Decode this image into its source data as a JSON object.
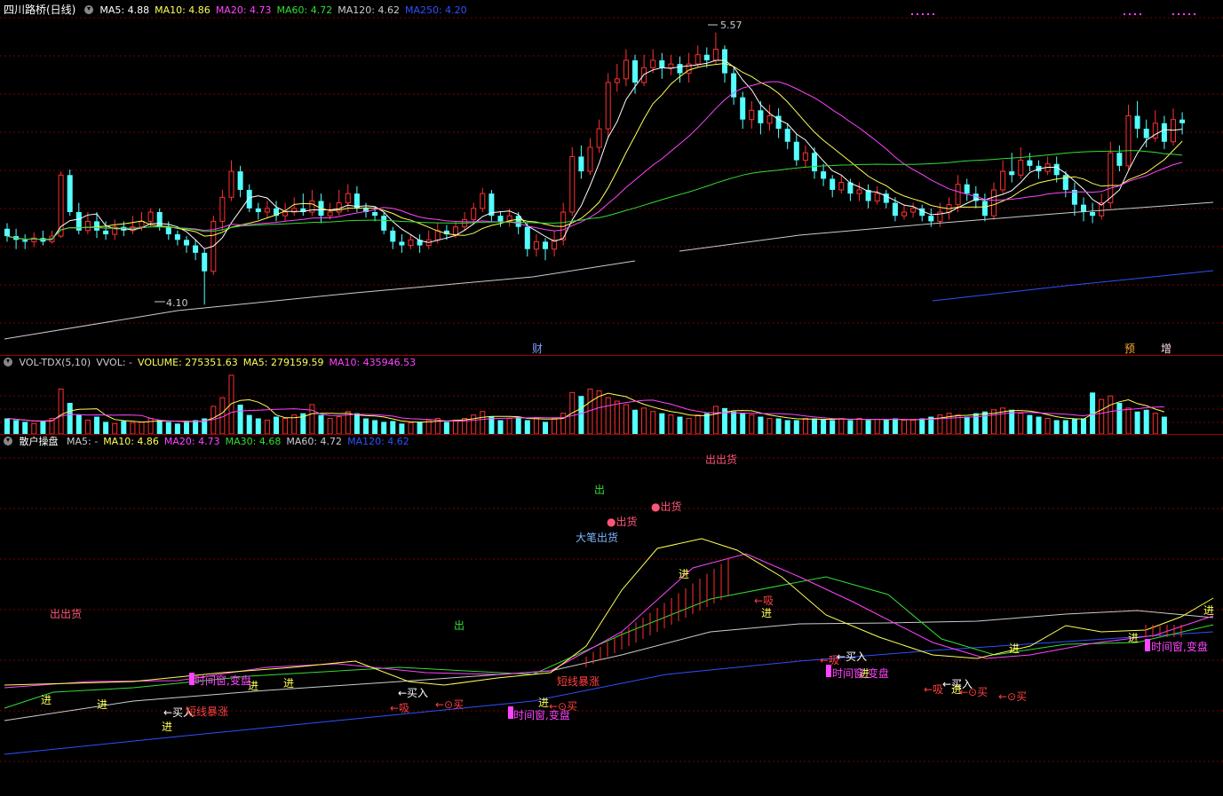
{
  "colors": {
    "up": "#ff3030",
    "down": "#54ffff",
    "ma5": "#ffffff",
    "ma10": "#ffff55",
    "ma20": "#ff44ff",
    "ma60": "#33dd33",
    "ma120": "#cccccc",
    "ma250": "#3050ff",
    "grid": "#7a0000"
  },
  "price_panel": {
    "stock_title": "四川路桥(日线)",
    "indicators": [
      {
        "label": "MA5: 4.88",
        "color": "#ffffff"
      },
      {
        "label": "MA10: 4.86",
        "color": "#ffff55"
      },
      {
        "label": "MA20: 4.73",
        "color": "#ff44ff"
      },
      {
        "label": "MA60: 4.72",
        "color": "#33dd33"
      },
      {
        "label": "MA120: 4.62",
        "color": "#cccccc"
      },
      {
        "label": "MA250: 4.20",
        "color": "#3050ff"
      }
    ],
    "high_label": "5.57",
    "low_label": "4.10",
    "markers": [
      {
        "text": "财",
        "color": "#7aa0ff"
      },
      {
        "text": "预",
        "color": "#ffaa33"
      },
      {
        "text": "增",
        "color": "#ffdddd"
      }
    ],
    "price_range": [
      3.9,
      5.65
    ],
    "candles": [
      [
        4.51,
        4.47,
        4.54,
        4.44
      ],
      [
        4.47,
        4.45,
        4.51,
        4.4
      ],
      [
        4.45,
        4.44,
        4.48,
        4.4
      ],
      [
        4.44,
        4.46,
        4.49,
        4.41
      ],
      [
        4.46,
        4.44,
        4.5,
        4.42
      ],
      [
        4.44,
        4.47,
        4.5,
        4.43
      ],
      [
        4.47,
        4.8,
        4.82,
        4.46
      ],
      [
        4.8,
        4.6,
        4.83,
        4.58
      ],
      [
        4.6,
        4.5,
        4.65,
        4.48
      ],
      [
        4.5,
        4.55,
        4.6,
        4.48
      ],
      [
        4.55,
        4.5,
        4.6,
        4.46
      ],
      [
        4.5,
        4.48,
        4.55,
        4.45
      ],
      [
        4.48,
        4.52,
        4.56,
        4.45
      ],
      [
        4.52,
        4.5,
        4.55,
        4.47
      ],
      [
        4.5,
        4.52,
        4.58,
        4.48
      ],
      [
        4.52,
        4.55,
        4.6,
        4.5
      ],
      [
        4.55,
        4.6,
        4.62,
        4.52
      ],
      [
        4.6,
        4.52,
        4.62,
        4.5
      ],
      [
        4.52,
        4.48,
        4.55,
        4.45
      ],
      [
        4.48,
        4.45,
        4.5,
        4.42
      ],
      [
        4.45,
        4.42,
        4.47,
        4.38
      ],
      [
        4.42,
        4.38,
        4.45,
        4.34
      ],
      [
        4.38,
        4.28,
        4.4,
        4.1
      ],
      [
        4.28,
        4.55,
        4.58,
        4.26
      ],
      [
        4.55,
        4.68,
        4.72,
        4.5
      ],
      [
        4.68,
        4.82,
        4.88,
        4.66
      ],
      [
        4.82,
        4.72,
        4.85,
        4.68
      ],
      [
        4.72,
        4.62,
        4.75,
        4.6
      ],
      [
        4.62,
        4.6,
        4.65,
        4.56
      ],
      [
        4.6,
        4.62,
        4.66,
        4.57
      ],
      [
        4.62,
        4.58,
        4.66,
        4.55
      ],
      [
        4.58,
        4.6,
        4.65,
        4.55
      ],
      [
        4.6,
        4.62,
        4.68,
        4.58
      ],
      [
        4.62,
        4.6,
        4.7,
        4.58
      ],
      [
        4.6,
        4.66,
        4.72,
        4.58
      ],
      [
        4.66,
        4.58,
        4.7,
        4.54
      ],
      [
        4.58,
        4.6,
        4.65,
        4.56
      ],
      [
        4.6,
        4.65,
        4.72,
        4.58
      ],
      [
        4.65,
        4.7,
        4.75,
        4.6
      ],
      [
        4.7,
        4.62,
        4.74,
        4.6
      ],
      [
        4.62,
        4.6,
        4.65,
        4.57
      ],
      [
        4.6,
        4.58,
        4.63,
        4.55
      ],
      [
        4.58,
        4.5,
        4.6,
        4.48
      ],
      [
        4.5,
        4.44,
        4.52,
        4.4
      ],
      [
        4.44,
        4.42,
        4.48,
        4.38
      ],
      [
        4.42,
        4.45,
        4.48,
        4.4
      ],
      [
        4.45,
        4.42,
        4.48,
        4.38
      ],
      [
        4.42,
        4.45,
        4.5,
        4.4
      ],
      [
        4.45,
        4.5,
        4.54,
        4.43
      ],
      [
        4.5,
        4.48,
        4.53,
        4.45
      ],
      [
        4.48,
        4.52,
        4.55,
        4.46
      ],
      [
        4.52,
        4.56,
        4.6,
        4.5
      ],
      [
        4.56,
        4.62,
        4.65,
        4.54
      ],
      [
        4.62,
        4.7,
        4.73,
        4.6
      ],
      [
        4.7,
        4.58,
        4.72,
        4.55
      ],
      [
        4.58,
        4.55,
        4.6,
        4.52
      ],
      [
        4.55,
        4.58,
        4.62,
        4.52
      ],
      [
        4.58,
        4.52,
        4.6,
        4.48
      ],
      [
        4.52,
        4.4,
        4.54,
        4.36
      ],
      [
        4.4,
        4.44,
        4.48,
        4.36
      ],
      [
        4.44,
        4.4,
        4.46,
        4.34
      ],
      [
        4.4,
        4.45,
        4.5,
        4.36
      ],
      [
        4.45,
        4.6,
        4.65,
        4.42
      ],
      [
        4.6,
        4.9,
        4.95,
        4.58
      ],
      [
        4.9,
        4.82,
        4.96,
        4.78
      ],
      [
        4.82,
        4.95,
        5.0,
        4.8
      ],
      [
        4.95,
        5.05,
        5.1,
        4.92
      ],
      [
        5.05,
        5.3,
        5.35,
        5.0
      ],
      [
        5.3,
        5.32,
        5.4,
        5.25
      ],
      [
        5.32,
        5.42,
        5.48,
        5.28
      ],
      [
        5.42,
        5.3,
        5.45,
        5.24
      ],
      [
        5.3,
        5.38,
        5.45,
        5.28
      ],
      [
        5.38,
        5.42,
        5.48,
        5.35
      ],
      [
        5.42,
        5.38,
        5.46,
        5.32
      ],
      [
        5.38,
        5.4,
        5.45,
        5.34
      ],
      [
        5.4,
        5.35,
        5.44,
        5.3
      ],
      [
        5.35,
        5.4,
        5.46,
        5.3
      ],
      [
        5.4,
        5.45,
        5.5,
        5.38
      ],
      [
        5.45,
        5.42,
        5.49,
        5.38
      ],
      [
        5.42,
        5.48,
        5.57,
        5.4
      ],
      [
        5.48,
        5.35,
        5.5,
        5.3
      ],
      [
        5.35,
        5.22,
        5.38,
        5.18
      ],
      [
        5.22,
        5.1,
        5.25,
        5.05
      ],
      [
        5.1,
        5.15,
        5.2,
        5.05
      ],
      [
        5.15,
        5.08,
        5.2,
        5.02
      ],
      [
        5.08,
        5.12,
        5.18,
        5.04
      ],
      [
        5.12,
        5.05,
        5.16,
        5.0
      ],
      [
        5.05,
        4.98,
        5.08,
        4.94
      ],
      [
        4.98,
        4.88,
        5.02,
        4.85
      ],
      [
        4.88,
        4.92,
        4.96,
        4.84
      ],
      [
        4.92,
        4.82,
        4.95,
        4.78
      ],
      [
        4.82,
        4.78,
        4.86,
        4.74
      ],
      [
        4.78,
        4.72,
        4.8,
        4.68
      ],
      [
        4.72,
        4.76,
        4.8,
        4.7
      ],
      [
        4.76,
        4.7,
        4.78,
        4.66
      ],
      [
        4.7,
        4.72,
        4.76,
        4.66
      ],
      [
        4.72,
        4.66,
        4.75,
        4.62
      ],
      [
        4.66,
        4.7,
        4.74,
        4.64
      ],
      [
        4.7,
        4.65,
        4.72,
        4.62
      ],
      [
        4.65,
        4.58,
        4.68,
        4.55
      ],
      [
        4.58,
        4.6,
        4.64,
        4.56
      ],
      [
        4.6,
        4.62,
        4.65,
        4.57
      ],
      [
        4.62,
        4.58,
        4.64,
        4.55
      ],
      [
        4.58,
        4.55,
        4.62,
        4.52
      ],
      [
        4.55,
        4.6,
        4.65,
        4.52
      ],
      [
        4.6,
        4.64,
        4.68,
        4.56
      ],
      [
        4.64,
        4.75,
        4.8,
        4.6
      ],
      [
        4.75,
        4.7,
        4.78,
        4.66
      ],
      [
        4.7,
        4.66,
        4.74,
        4.62
      ],
      [
        4.66,
        4.58,
        4.7,
        4.55
      ],
      [
        4.58,
        4.72,
        4.76,
        4.56
      ],
      [
        4.72,
        4.82,
        4.88,
        4.7
      ],
      [
        4.82,
        4.8,
        4.92,
        4.76
      ],
      [
        4.8,
        4.88,
        4.95,
        4.78
      ],
      [
        4.88,
        4.85,
        4.92,
        4.82
      ],
      [
        4.85,
        4.82,
        4.88,
        4.78
      ],
      [
        4.82,
        4.86,
        4.9,
        4.8
      ],
      [
        4.86,
        4.8,
        4.9,
        4.76
      ],
      [
        4.8,
        4.72,
        4.82,
        4.68
      ],
      [
        4.72,
        4.64,
        4.76,
        4.58
      ],
      [
        4.64,
        4.6,
        4.68,
        4.55
      ],
      [
        4.6,
        4.58,
        4.65,
        4.54
      ],
      [
        4.58,
        4.65,
        4.7,
        4.56
      ],
      [
        4.65,
        4.92,
        4.98,
        4.62
      ],
      [
        4.92,
        4.85,
        4.96,
        4.82
      ],
      [
        4.85,
        5.12,
        5.18,
        4.83
      ],
      [
        5.12,
        5.05,
        5.2,
        5.0
      ],
      [
        5.05,
        5.0,
        5.1,
        4.95
      ],
      [
        5.0,
        5.08,
        5.15,
        4.98
      ],
      [
        5.08,
        4.98,
        5.12,
        4.94
      ],
      [
        4.98,
        5.1,
        5.16,
        4.96
      ],
      [
        5.1,
        5.08,
        5.14,
        5.02
      ]
    ]
  },
  "vol_panel": {
    "indicators": [
      {
        "label": "VOL-TDX(5,10)",
        "color": "#cccccc"
      },
      {
        "label": "VVOL: -",
        "color": "#cccccc"
      },
      {
        "label": "VOLUME: 275351.63",
        "color": "#ffff55"
      },
      {
        "label": "MA5: 279159.59",
        "color": "#ffff55"
      },
      {
        "label": "MA10: 435946.53",
        "color": "#ff44ff"
      }
    ],
    "volumes": [
      18,
      16,
      14,
      12,
      15,
      18,
      52,
      36,
      22,
      16,
      20,
      14,
      12,
      15,
      13,
      14,
      18,
      16,
      14,
      12,
      14,
      16,
      18,
      32,
      42,
      68,
      34,
      22,
      18,
      16,
      20,
      18,
      22,
      24,
      34,
      22,
      18,
      20,
      26,
      24,
      18,
      16,
      14,
      15,
      12,
      13,
      14,
      16,
      18,
      14,
      16,
      18,
      22,
      26,
      20,
      16,
      18,
      20,
      16,
      18,
      14,
      18,
      24,
      48,
      44,
      52,
      50,
      42,
      38,
      34,
      28,
      30,
      26,
      24,
      22,
      20,
      18,
      22,
      24,
      32,
      30,
      26,
      24,
      22,
      20,
      18,
      18,
      16,
      16,
      18,
      18,
      17,
      16,
      18,
      16,
      18,
      16,
      17,
      16,
      18,
      16,
      16,
      18,
      20,
      22,
      24,
      22,
      20,
      24,
      26,
      28,
      30,
      28,
      24,
      22,
      20,
      18,
      16,
      16,
      18,
      18,
      48,
      40,
      44,
      36,
      30,
      26,
      28,
      24,
      20
    ],
    "vol_max": 72
  },
  "ind_panel": {
    "title": "散户操盘",
    "indicators": [
      {
        "label": "MA5: -",
        "color": "#cccccc"
      },
      {
        "label": "MA10: 4.86",
        "color": "#ffff55"
      },
      {
        "label": "MA20: 4.73",
        "color": "#ff44ff"
      },
      {
        "label": "MA30: 4.68",
        "color": "#33dd33"
      },
      {
        "label": "MA60: 4.72",
        "color": "#cccccc"
      },
      {
        "label": "MA120: 4.62",
        "color": "#3050ff"
      }
    ],
    "signals": [
      {
        "text": "出出货",
        "color": "#ff5577"
      },
      {
        "text": "出",
        "color": "#33dd33"
      },
      {
        "text": "●出货",
        "color": "#ff5577"
      },
      {
        "text": "●出货",
        "color": "#ff5577"
      },
      {
        "text": "大笔出货",
        "color": "#7ab8ff"
      },
      {
        "text": "出出货",
        "color": "#ff5577"
      },
      {
        "text": "出",
        "color": "#33dd33"
      },
      {
        "text": "进",
        "color": "#ffff55"
      },
      {
        "text": "←吸",
        "color": "#ff4040"
      },
      {
        "text": "进",
        "color": "#ffff55"
      },
      {
        "text": "进",
        "color": "#ffff55"
      },
      {
        "text": "进",
        "color": "#ffff55"
      },
      {
        "text": "←买入",
        "color": "#ffffff"
      },
      {
        "text": "进",
        "color": "#ffff55"
      },
      {
        "text": "进",
        "color": "#ffff55"
      },
      {
        "text": "进",
        "color": "#ffff55"
      },
      {
        "text": "←买入",
        "color": "#ffffff"
      },
      {
        "text": "←吸",
        "color": "#ff4040"
      },
      {
        "text": "←⊙买",
        "color": "#ff4040"
      },
      {
        "text": "进",
        "color": "#ffff55"
      },
      {
        "text": "←⊙买",
        "color": "#ff4040"
      },
      {
        "text": "短线暴涨",
        "color": "#ff4040"
      },
      {
        "text": "短线暴涨",
        "color": "#ff4040"
      },
      {
        "text": "时间窗,变盘",
        "color": "#ff44ff"
      },
      {
        "text": "时间窗,变盘",
        "color": "#ff44ff"
      },
      {
        "text": "←吸",
        "color": "#ff4040"
      },
      {
        "text": "←买入",
        "color": "#ffffff"
      },
      {
        "text": "进",
        "color": "#ffff55"
      },
      {
        "text": "时间窗,变盘",
        "color": "#ff44ff"
      },
      {
        "text": "←吸",
        "color": "#ff4040"
      },
      {
        "text": "←买入",
        "color": "#ffffff"
      },
      {
        "text": "进",
        "color": "#ffff55"
      },
      {
        "text": "←⊙买",
        "color": "#ff4040"
      },
      {
        "text": "←⊙买",
        "color": "#ff4040"
      },
      {
        "text": "进",
        "color": "#ffff55"
      },
      {
        "text": "进",
        "color": "#ffff55"
      },
      {
        "text": "时间窗,变盘",
        "color": "#ff44ff"
      },
      {
        "text": "进",
        "color": "#ffff55"
      }
    ]
  }
}
